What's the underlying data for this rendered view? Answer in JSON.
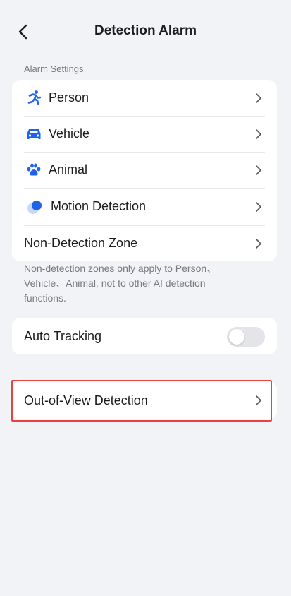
{
  "header": {
    "title": "Detection Alarm"
  },
  "alarm_settings": {
    "section_label": "Alarm Settings",
    "items": [
      {
        "label": "Person",
        "icon": "person-running-icon"
      },
      {
        "label": "Vehicle",
        "icon": "car-icon"
      },
      {
        "label": "Animal",
        "icon": "paw-icon"
      },
      {
        "label": "Motion Detection",
        "icon": "motion-icon"
      },
      {
        "label": "Non-Detection Zone",
        "icon": ""
      }
    ],
    "note": "Non-detection zones only apply to Person、Vehicle、Animal, not to other AI detection functions."
  },
  "auto_tracking": {
    "label": "Auto Tracking",
    "enabled": false
  },
  "out_of_view": {
    "label": "Out-of-View Detection"
  },
  "colors": {
    "accent": "#1e63e9",
    "highlight": "#e5453e",
    "background": "#f2f3f6"
  }
}
